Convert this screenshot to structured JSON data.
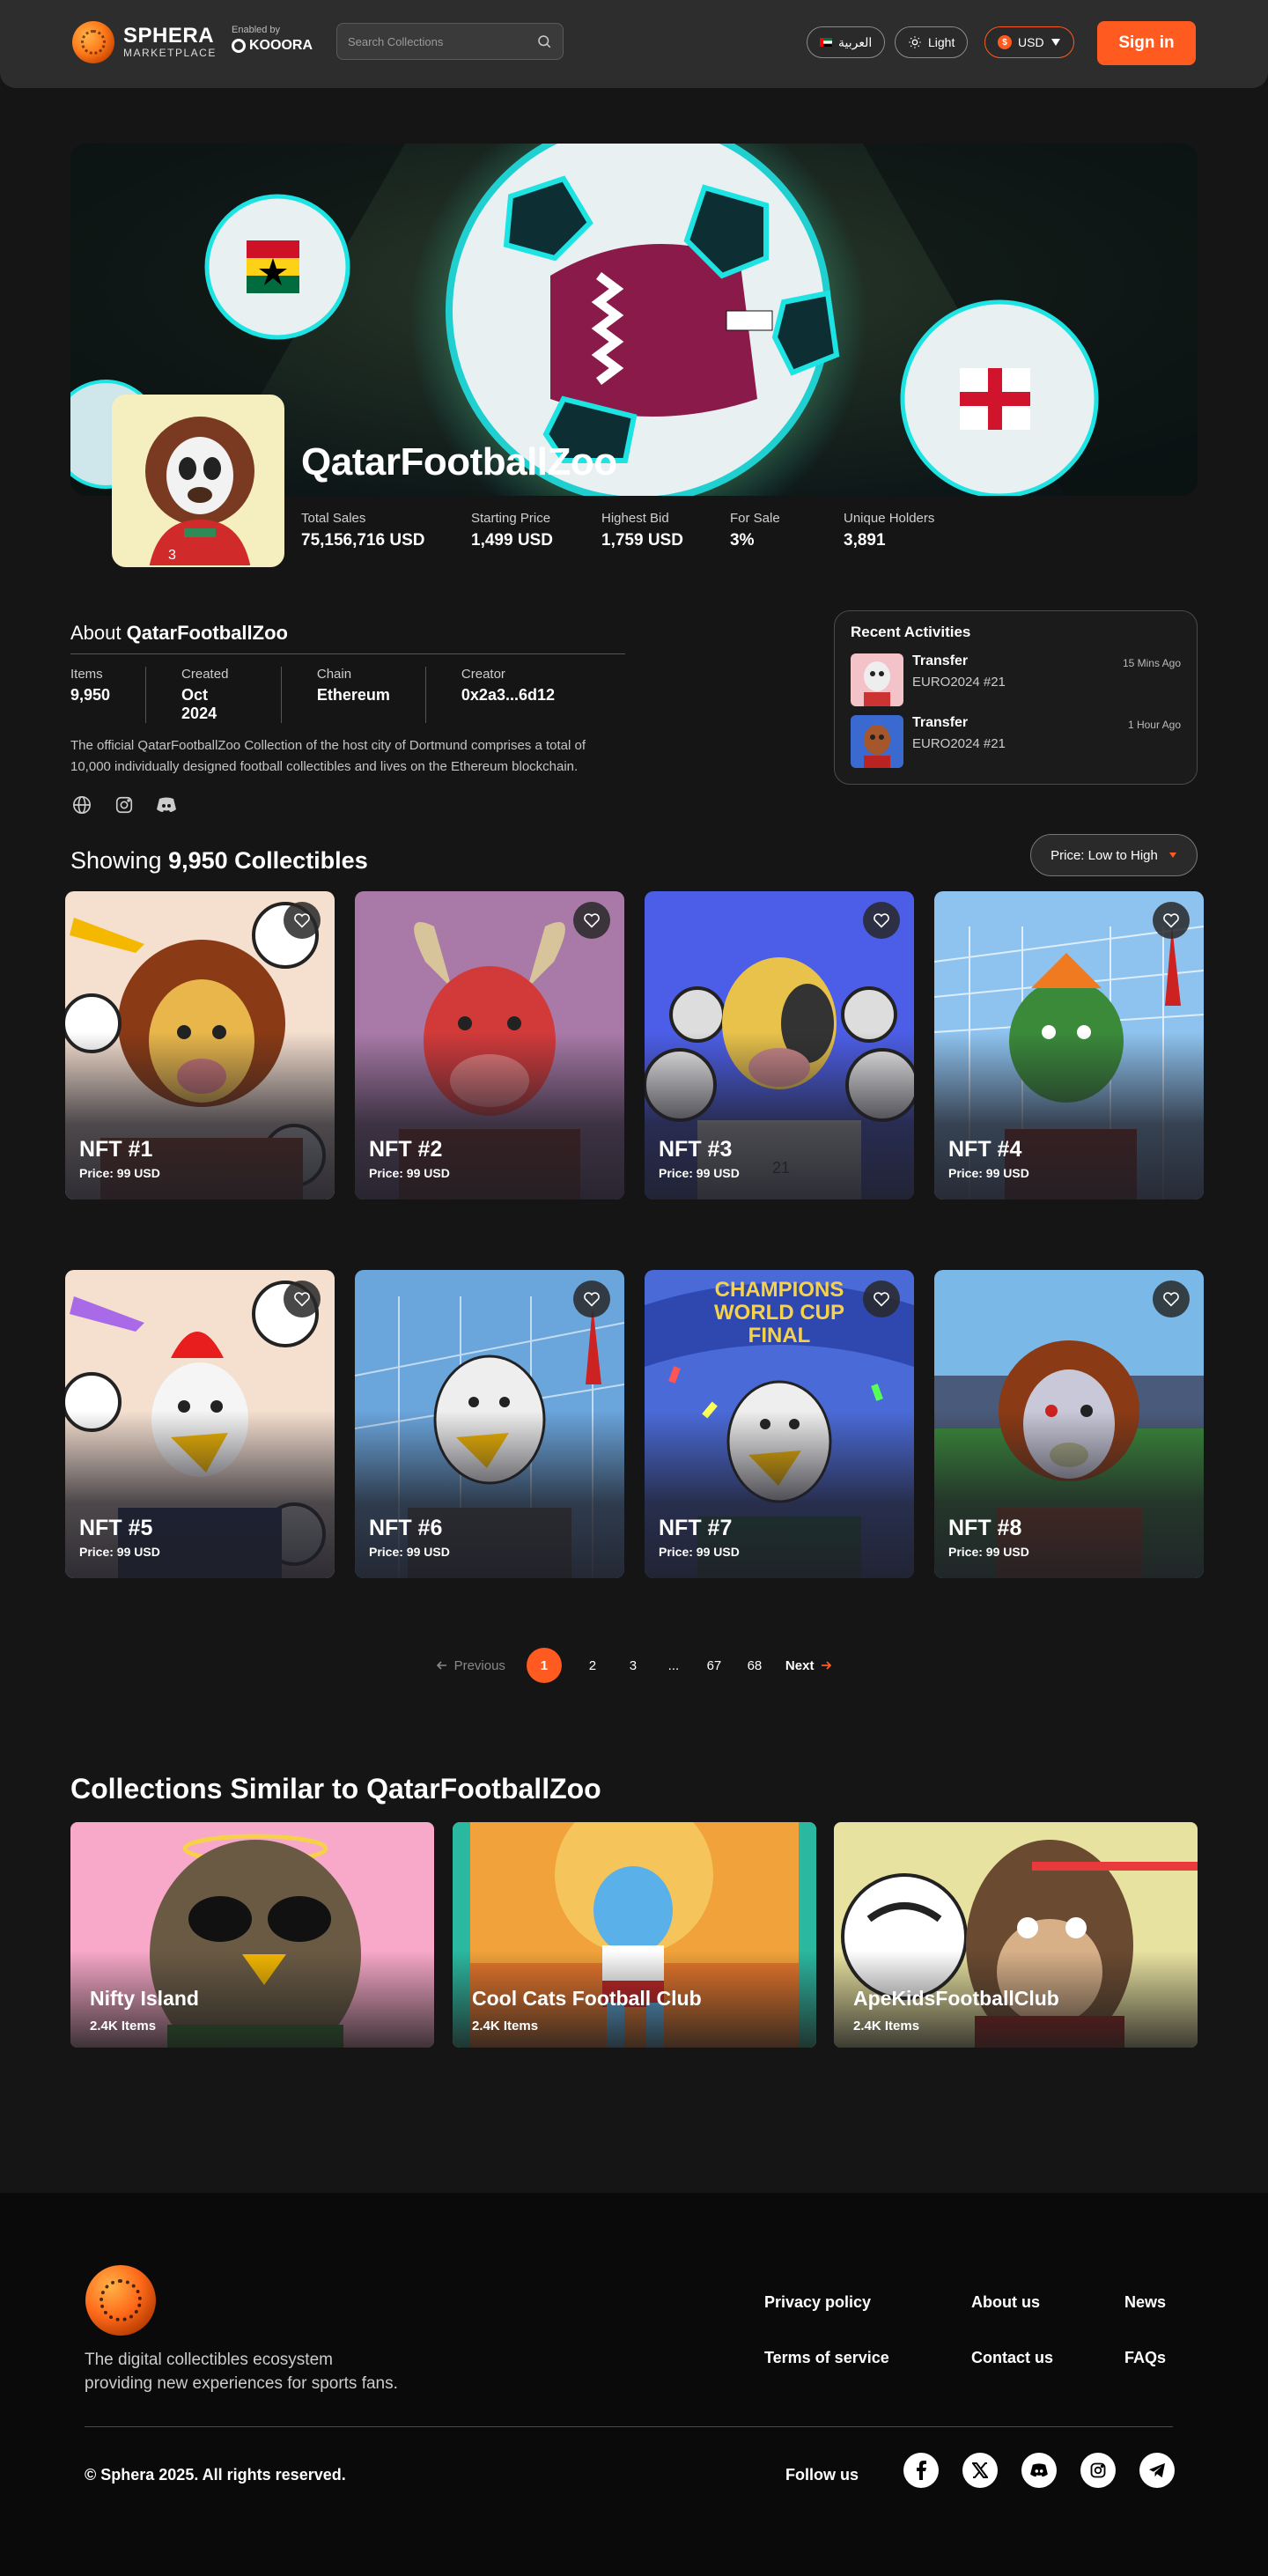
{
  "header": {
    "logo_title": "SPHERA",
    "logo_subtitle": "MARKETPLACE",
    "enabled_by": "Enabled by",
    "enabled_brand": "KOOORA",
    "search_placeholder": "Search Collections",
    "language": "العربية",
    "theme": "Light",
    "currency": "USD",
    "signin": "Sign in",
    "accent": "#ff5a1f"
  },
  "collection": {
    "title": "QatarFootballZoo",
    "stats": [
      {
        "label": "Total Sales",
        "value": "75,156,716 USD"
      },
      {
        "label": "Starting Price",
        "value": "1,499 USD"
      },
      {
        "label": "Highest Bid",
        "value": "1,759 USD"
      },
      {
        "label": "For Sale",
        "value": "3%"
      },
      {
        "label": "Unique Holders",
        "value": "3,891"
      }
    ]
  },
  "about": {
    "prefix": "About",
    "name": "QatarFootballZoo",
    "meta": [
      {
        "label": "Items",
        "value": "9,950"
      },
      {
        "label": "Created",
        "value": "Oct 2024"
      },
      {
        "label": "Chain",
        "value": "Ethereum"
      },
      {
        "label": "Creator",
        "value": "0x2a3...6d12"
      }
    ],
    "description": "The official QatarFootballZoo Collection of the host city of Dortmund comprises a total of 10,000 individually designed football collectibles and lives on the Ethereum blockchain.",
    "social_icons": [
      "globe-icon",
      "instagram-icon",
      "discord-icon"
    ]
  },
  "recent": {
    "title": "Recent Activities",
    "items": [
      {
        "type": "Transfer",
        "item": "EURO2024 #21",
        "time": "15 Mins Ago"
      },
      {
        "type": "Transfer",
        "item": "EURO2024 #21",
        "time": "1 Hour Ago"
      }
    ]
  },
  "listing": {
    "showing_prefix": "Showing",
    "count": "9,950 Collectibles",
    "sort": "Price: Low to High"
  },
  "nfts": [
    {
      "name": "NFT #1",
      "price": "Price: 99 USD"
    },
    {
      "name": "NFT #2",
      "price": "Price: 99 USD"
    },
    {
      "name": "NFT #3",
      "price": "Price: 99 USD"
    },
    {
      "name": "NFT #4",
      "price": "Price: 99 USD"
    },
    {
      "name": "NFT #5",
      "price": "Price: 99 USD"
    },
    {
      "name": "NFT #6",
      "price": "Price: 99 USD"
    },
    {
      "name": "NFT #7",
      "price": "Price: 99 USD"
    },
    {
      "name": "NFT #8",
      "price": "Price: 99 USD"
    }
  ],
  "card_art_text": {
    "line1": "CHAMPIONS",
    "line2": "WORLD CUP",
    "line3": "FINAL"
  },
  "pagination": {
    "prev": "Previous",
    "pages": [
      "1",
      "2",
      "3",
      "...",
      "67",
      "68"
    ],
    "active": "1",
    "next": "Next"
  },
  "similar": {
    "title": "Collections Similar to QatarFootballZoo",
    "items": [
      {
        "name": "Nifty Island",
        "count": "2.4K Items"
      },
      {
        "name": "Cool Cats Football Club",
        "count": "2.4K Items"
      },
      {
        "name": "ApeKidsFootballClub",
        "count": "2.4K Items"
      }
    ]
  },
  "footer": {
    "tagline": "The digital collectibles ecosystem providing new experiences for sports fans.",
    "links": [
      "Privacy policy",
      "About us",
      "News",
      "Terms of service",
      "Contact us",
      "FAQs"
    ],
    "copyright": "© Sphera 2025. All rights reserved.",
    "follow": "Follow us",
    "social_icons": [
      "facebook-icon",
      "x-icon",
      "discord-icon",
      "instagram-icon",
      "telegram-icon"
    ]
  }
}
